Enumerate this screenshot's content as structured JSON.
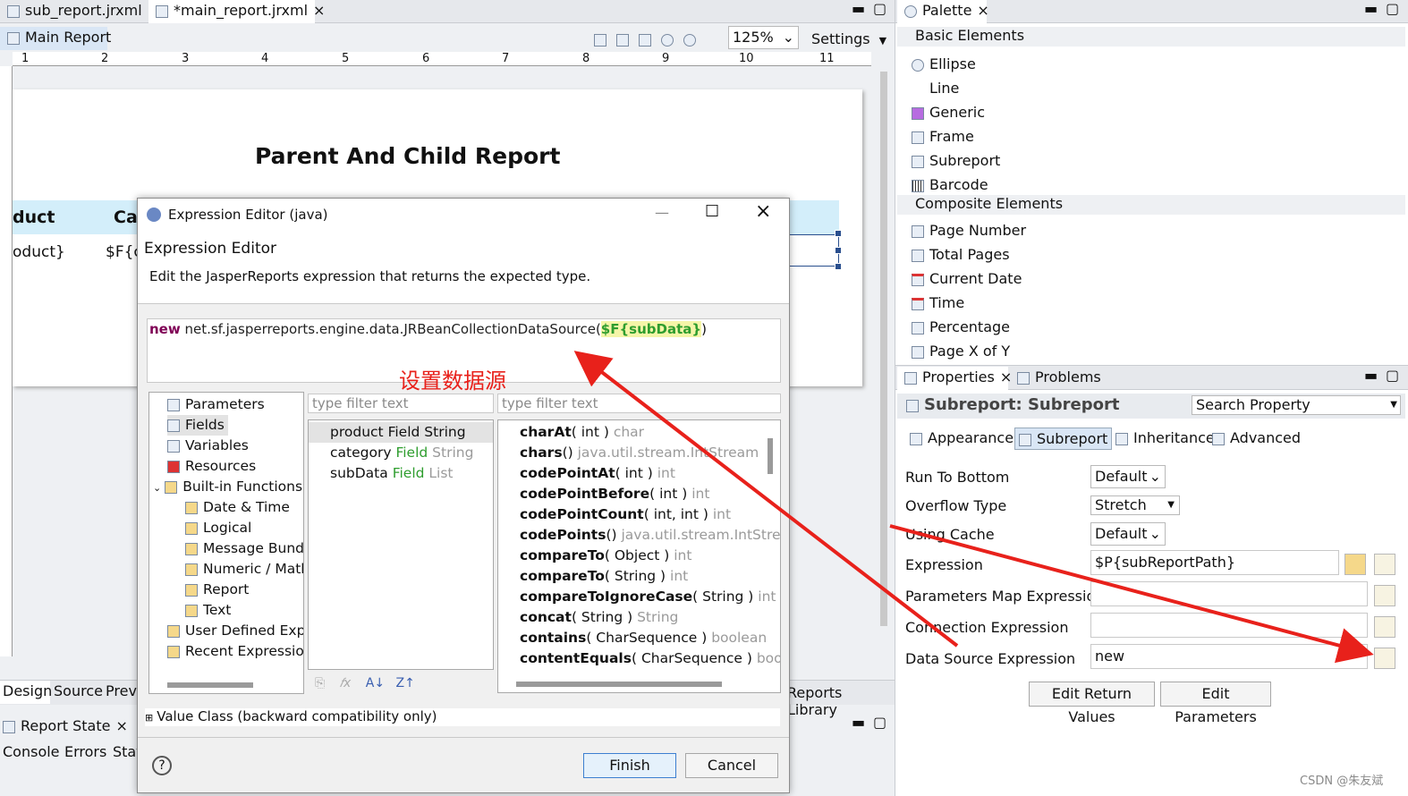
{
  "editor_tabs": [
    "sub_report.jrxml",
    "*main_report.jrxml"
  ],
  "report_tab": "Main Report",
  "zoom": "125%",
  "settings": "Settings",
  "ruler": [
    "1",
    "2",
    "3",
    "4",
    "5",
    "6",
    "7",
    "8",
    "9",
    "10",
    "11"
  ],
  "report": {
    "title": "Parent And Child Report",
    "col1_header": "duct",
    "col2_header": "Ca",
    "col1_cell": "oduct}",
    "col2_cell": "$F{c"
  },
  "bottom_tabs": [
    "Design",
    "Source",
    "Previ"
  ],
  "reports_library": "Reports Library",
  "report_state": "Report State",
  "console_tabs": [
    "Console",
    "Errors",
    "Stat"
  ],
  "dialog": {
    "window_title": "Expression Editor (java)",
    "heading": "Expression Editor",
    "description": "Edit the JasperReports expression that returns the expected type.",
    "expr_keyword": "new",
    "expr_body": " net.sf.jasperreports.engine.data.JRBeanCollectionDataSource(",
    "expr_field": "$F{subData}",
    "expr_end": ")",
    "annotation": "设置数据源",
    "tree": [
      "Parameters",
      "Fields",
      "Variables",
      "Resources",
      "Built-in Functions",
      "Date & Time",
      "Logical",
      "Message Bundl",
      "Numeric / Math",
      "Report",
      "Text",
      "User Defined Expr",
      "Recent Expression"
    ],
    "filter_placeholder": "type filter text",
    "fields": [
      {
        "name": "product",
        "kind": "Field",
        "type": "String"
      },
      {
        "name": "category",
        "kind": "Field",
        "type": "String"
      },
      {
        "name": "subData",
        "kind": "Field",
        "type": "List"
      }
    ],
    "methods": [
      {
        "name": "charAt",
        "args": "( int )",
        "ret": "char"
      },
      {
        "name": "chars",
        "args": "()",
        "ret": "java.util.stream.IntStream"
      },
      {
        "name": "codePointAt",
        "args": "( int )",
        "ret": "int"
      },
      {
        "name": "codePointBefore",
        "args": "( int )",
        "ret": "int"
      },
      {
        "name": "codePointCount",
        "args": "( int, int )",
        "ret": "int"
      },
      {
        "name": "codePoints",
        "args": "()",
        "ret": "java.util.stream.IntStream"
      },
      {
        "name": "compareTo",
        "args": "( Object )",
        "ret": "int"
      },
      {
        "name": "compareTo",
        "args": "( String )",
        "ret": "int"
      },
      {
        "name": "compareToIgnoreCase",
        "args": "( String )",
        "ret": "int"
      },
      {
        "name": "concat",
        "args": "( String )",
        "ret": "String"
      },
      {
        "name": "contains",
        "args": "( CharSequence )",
        "ret": "boolean"
      },
      {
        "name": "contentEquals",
        "args": "( CharSequence )",
        "ret": "bool"
      }
    ],
    "value_class": "Value Class (backward compatibility only)",
    "finish": "Finish",
    "cancel": "Cancel"
  },
  "palette": {
    "title": "Palette",
    "basic_header": "Basic Elements",
    "basic": [
      "Ellipse",
      "Line",
      "Generic",
      "Frame",
      "Subreport",
      "Barcode"
    ],
    "composite_header": "Composite Elements",
    "composite": [
      "Page Number",
      "Total Pages",
      "Current Date",
      "Time",
      "Percentage",
      "Page X of Y"
    ]
  },
  "properties": {
    "tabs": [
      "Properties",
      "Problems"
    ],
    "title": "Subreport: Subreport",
    "search": "Search Property",
    "subtabs": [
      "Appearance",
      "Subreport",
      "Inheritance",
      "Advanced"
    ],
    "labels": [
      "Run To Bottom",
      "Overflow Type",
      "Using Cache",
      "Expression",
      "Parameters Map Expression",
      "Connection Expression",
      "Data Source Expression"
    ],
    "values": {
      "run_to_bottom": "Default",
      "overflow": "Stretch",
      "cache": "Default",
      "expression": "$P{subReportPath}",
      "datasource": "new"
    },
    "edit_return": "Edit Return Values",
    "edit_params": "Edit Parameters"
  },
  "watermark": "CSDN @朱友斌",
  "colors": {
    "accent": "#d3eefa",
    "arrow": "#e8211b",
    "green": "#2e9d2e"
  }
}
